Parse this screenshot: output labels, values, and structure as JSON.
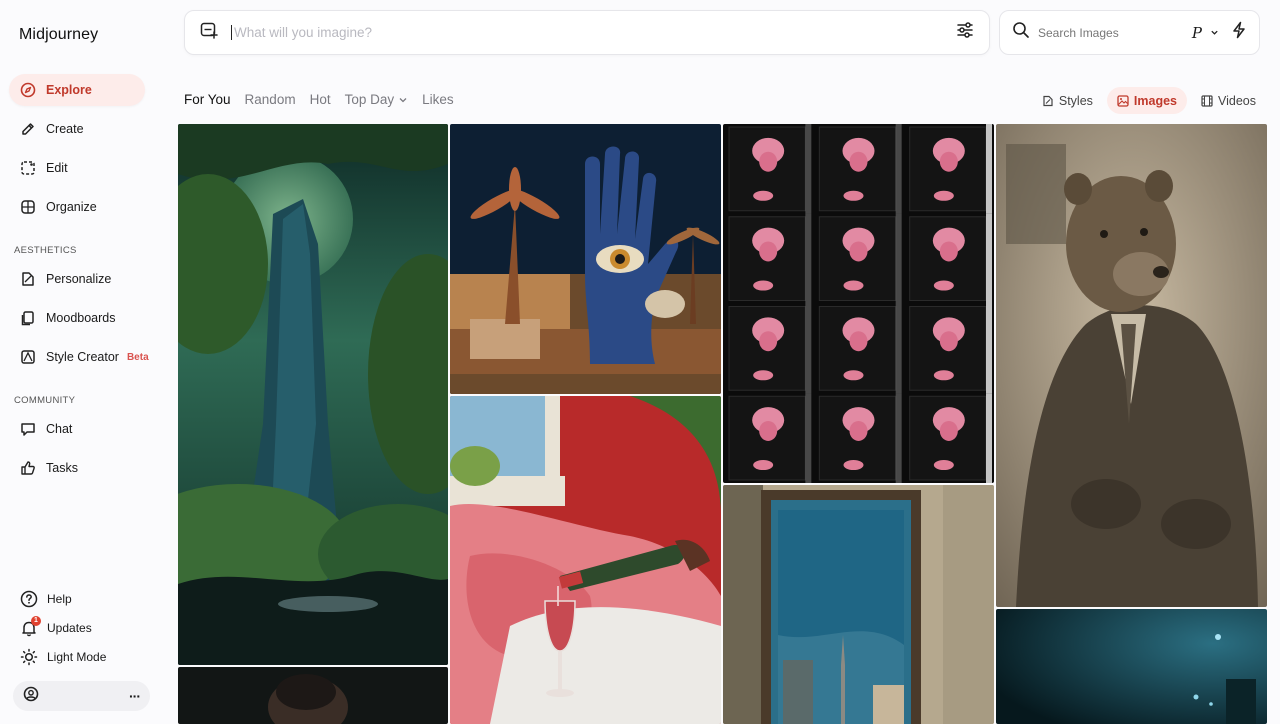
{
  "app": {
    "brand": "Midjourney"
  },
  "sidebar": {
    "main_items": [
      {
        "label": "Explore",
        "icon": "compass-icon",
        "active": true
      },
      {
        "label": "Create",
        "icon": "brush-icon"
      },
      {
        "label": "Edit",
        "icon": "edit-frame-icon"
      },
      {
        "label": "Organize",
        "icon": "grid-icon"
      }
    ],
    "aesthetics_label": "AESTHETICS",
    "aesthetics_items": [
      {
        "label": "Personalize",
        "icon": "personalize-icon"
      },
      {
        "label": "Moodboards",
        "icon": "moodboard-icon"
      },
      {
        "label": "Style Creator",
        "icon": "palette-icon",
        "tag": "Beta"
      }
    ],
    "community_label": "COMMUNITY",
    "community_items": [
      {
        "label": "Chat",
        "icon": "chat-icon"
      },
      {
        "label": "Tasks",
        "icon": "thumbs-up-icon"
      }
    ],
    "bottom_items": [
      {
        "label": "Help",
        "icon": "help-icon"
      },
      {
        "label": "Updates",
        "icon": "bell-icon",
        "badge": "1"
      },
      {
        "label": "Light Mode",
        "icon": "sun-icon"
      }
    ],
    "user_menu": "···"
  },
  "prompt": {
    "placeholder": "What will you imagine?"
  },
  "search": {
    "placeholder": "Search Images",
    "profile_mode": "P"
  },
  "feed_tabs": [
    "For You",
    "Random",
    "Hot",
    "Top Day",
    "Likes"
  ],
  "type_tabs": [
    {
      "label": "Styles",
      "icon": "styles-icon"
    },
    {
      "label": "Images",
      "icon": "image-icon",
      "active": true
    },
    {
      "label": "Videos",
      "icon": "film-icon"
    }
  ],
  "accent": "#c0392b"
}
